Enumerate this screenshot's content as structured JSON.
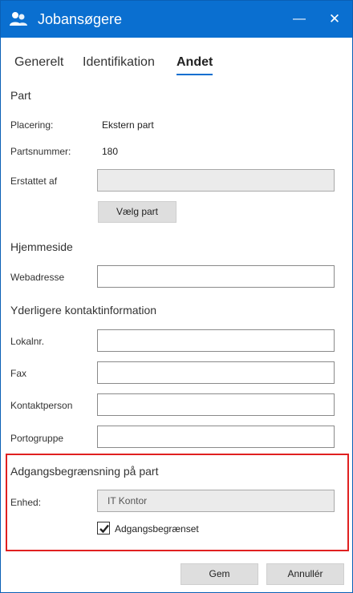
{
  "window": {
    "title": "Jobansøgere",
    "app_icon": "group-people-icon",
    "minimize_glyph": "—",
    "close_glyph": "✕"
  },
  "tabs": [
    {
      "label": "Generelt",
      "active": false
    },
    {
      "label": "Identifikation",
      "active": false
    },
    {
      "label": "Andet",
      "active": true
    }
  ],
  "part": {
    "heading": "Part",
    "placering_label": "Placering:",
    "placering_value": "Ekstern part",
    "partsnummer_label": "Partsnummer:",
    "partsnummer_value": "180",
    "erstattet_label": "Erstattet af",
    "erstattet_value": "",
    "choose_button": "Vælg part"
  },
  "hjemmeside": {
    "heading": "Hjemmeside",
    "web_label": "Webadresse",
    "web_value": ""
  },
  "kontakt": {
    "heading": "Yderligere kontaktinformation",
    "lokalnr_label": "Lokalnr.",
    "fax_label": "Fax",
    "kontaktperson_label": "Kontaktperson",
    "portogruppe_label": "Portogruppe"
  },
  "adgang": {
    "heading": "Adgangsbegrænsning på part",
    "enhed_label": "Enhed:",
    "enhed_value": "IT Kontor",
    "checkbox_label": "Adgangsbegrænset",
    "checkbox_checked": true
  },
  "footer": {
    "save_button": "Gem",
    "cancel_button": "Annullér"
  },
  "colors": {
    "titlebar": "#0a6fd0",
    "highlight": "#e02020"
  }
}
